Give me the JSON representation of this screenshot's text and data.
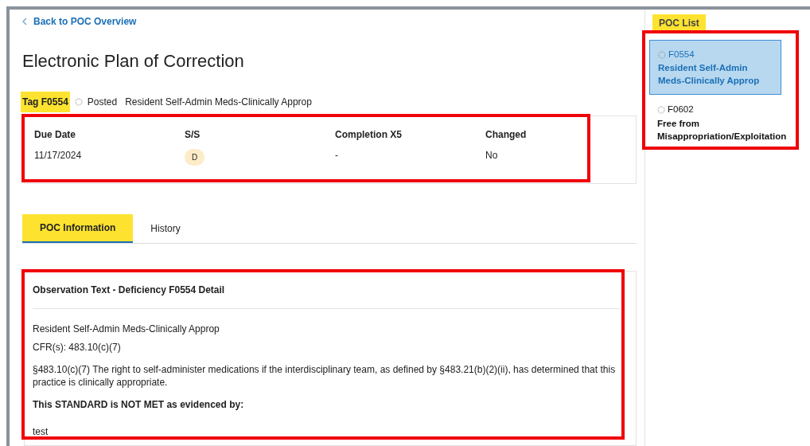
{
  "back_link": {
    "label": "Back to POC Overview"
  },
  "title": "Electronic Plan of Correction",
  "tag": {
    "label": "Tag F0554",
    "status": "Posted",
    "name": "Resident Self-Admin Meds-Clinically Approp"
  },
  "summary": [
    {
      "label": "Due Date",
      "value": "11/17/2024",
      "kind": "text"
    },
    {
      "label": "S/S",
      "value": "D",
      "kind": "badge"
    },
    {
      "label": "Completion X5",
      "value": "-",
      "kind": "text"
    },
    {
      "label": "Changed",
      "value": "No",
      "kind": "text"
    }
  ],
  "tabs": [
    {
      "label": "POC Information",
      "selected": true
    },
    {
      "label": "History",
      "selected": false
    }
  ],
  "observation": {
    "title": "Observation Text - Deficiency F0554 Detail",
    "name": "Resident Self-Admin Meds-Clinically Approp",
    "cfr": "CFR(s): 483.10(c)(7)",
    "text": "§483.10(c)(7) The right to self-administer medications if the interdisciplinary team, as defined by §483.21(b)(2)(ii), has determined that this practice is clinically appropriate.",
    "standard": "This STANDARD is NOT MET as evidenced by:",
    "evidence": "test"
  },
  "poc_list": {
    "title": "POC List",
    "items": [
      {
        "code": "F0554",
        "name": "Resident Self-Admin Meds-Clinically Approp",
        "selected": true
      },
      {
        "code": "F0602",
        "name": "Free from Misappropriation/Exploitation",
        "selected": false
      }
    ]
  }
}
